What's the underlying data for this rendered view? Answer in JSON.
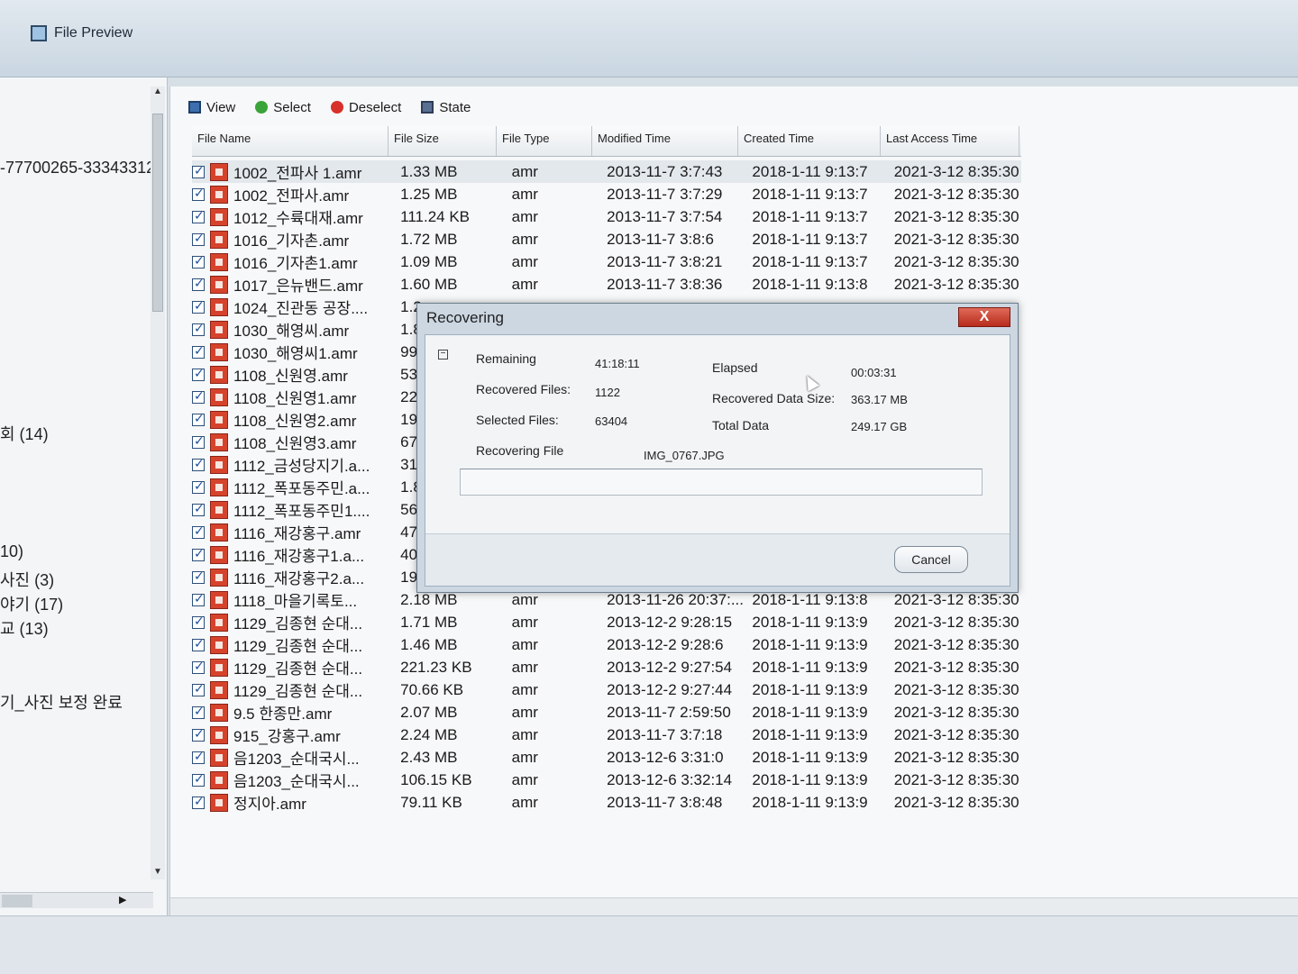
{
  "window": {
    "title": "File Preview"
  },
  "toolbar": {
    "view": "View",
    "select": "Select",
    "deselect": "Deselect",
    "state": "State"
  },
  "left_tree": [
    "-77700265-33343312",
    "회 (14)",
    "10)",
    "사진 (3)",
    "야기 (17)",
    "교 (13)",
    "기_사진 보정 완료"
  ],
  "table": {
    "headers": [
      "File Name",
      "File Size",
      "File Type",
      "Modified Time",
      "Created Time",
      "Last Access Time"
    ],
    "rows": [
      [
        "1002_전파사 1.amr",
        "1.33 MB",
        "amr",
        "2013-11-7 3:7:43",
        "2018-1-11 9:13:7",
        "2021-3-12 8:35:30"
      ],
      [
        "1002_전파사.amr",
        "1.25 MB",
        "amr",
        "2013-11-7 3:7:29",
        "2018-1-11 9:13:7",
        "2021-3-12 8:35:30"
      ],
      [
        "1012_수륙대재.amr",
        "111.24 KB",
        "amr",
        "2013-11-7 3:7:54",
        "2018-1-11 9:13:7",
        "2021-3-12 8:35:30"
      ],
      [
        "1016_기자촌.amr",
        "1.72 MB",
        "amr",
        "2013-11-7 3:8:6",
        "2018-1-11 9:13:7",
        "2021-3-12 8:35:30"
      ],
      [
        "1016_기자촌1.amr",
        "1.09 MB",
        "amr",
        "2013-11-7 3:8:21",
        "2018-1-11 9:13:7",
        "2021-3-12 8:35:30"
      ],
      [
        "1017_은뉴밴드.amr",
        "1.60 MB",
        "amr",
        "2013-11-7 3:8:36",
        "2018-1-11 9:13:8",
        "2021-3-12 8:35:30"
      ],
      [
        "1024_진관동 공장....",
        "1.2",
        "",
        "",
        "",
        ""
      ],
      [
        "1030_해영씨.amr",
        "1.8",
        "",
        "",
        "",
        ""
      ],
      [
        "1030_해영씨1.amr",
        "99",
        "",
        "",
        "",
        ""
      ],
      [
        "1108_신원영.amr",
        "53",
        "",
        "",
        "",
        ""
      ],
      [
        "1108_신원영1.amr",
        "22",
        "",
        "",
        "",
        ""
      ],
      [
        "1108_신원영2.amr",
        "19.",
        "",
        "",
        "",
        ""
      ],
      [
        "1108_신원영3.amr",
        "67.",
        "",
        "",
        "",
        ""
      ],
      [
        "1112_금성당지기.a...",
        "31.",
        "",
        "",
        "",
        ""
      ],
      [
        "1112_폭포동주민.a...",
        "1.8",
        "",
        "",
        "",
        ""
      ],
      [
        "1112_폭포동주민1....",
        "56",
        "",
        "",
        "",
        ""
      ],
      [
        "1116_재강홍구.amr",
        "47.",
        "",
        "",
        "",
        ""
      ],
      [
        "1116_재강홍구1.a...",
        "40",
        "",
        "",
        "",
        ""
      ],
      [
        "1116_재강홍구2.a...",
        "19",
        "",
        "",
        "",
        ""
      ],
      [
        "1118_마을기록토...",
        "2.18 MB",
        "amr",
        "2013-11-26 20:37:...",
        "2018-1-11 9:13:8",
        "2021-3-12 8:35:30"
      ],
      [
        "1129_김종현 순대...",
        "1.71 MB",
        "amr",
        "2013-12-2 9:28:15",
        "2018-1-11 9:13:9",
        "2021-3-12 8:35:30"
      ],
      [
        "1129_김종현 순대...",
        "1.46 MB",
        "amr",
        "2013-12-2 9:28:6",
        "2018-1-11 9:13:9",
        "2021-3-12 8:35:30"
      ],
      [
        "1129_김종현 순대...",
        "221.23 KB",
        "amr",
        "2013-12-2 9:27:54",
        "2018-1-11 9:13:9",
        "2021-3-12 8:35:30"
      ],
      [
        "1129_김종현 순대...",
        "70.66 KB",
        "amr",
        "2013-12-2 9:27:44",
        "2018-1-11 9:13:9",
        "2021-3-12 8:35:30"
      ],
      [
        "9.5 한종만.amr",
        "2.07 MB",
        "amr",
        "2013-11-7 2:59:50",
        "2018-1-11 9:13:9",
        "2021-3-12 8:35:30"
      ],
      [
        "915_강홍구.amr",
        "2.24 MB",
        "amr",
        "2013-11-7 3:7:18",
        "2018-1-11 9:13:9",
        "2021-3-12 8:35:30"
      ],
      [
        "음1203_순대국시...",
        "2.43 MB",
        "amr",
        "2013-12-6 3:31:0",
        "2018-1-11 9:13:9",
        "2021-3-12 8:35:30"
      ],
      [
        "음1203_순대국시...",
        "106.15 KB",
        "amr",
        "2013-12-6 3:32:14",
        "2018-1-11 9:13:9",
        "2021-3-12 8:35:30"
      ],
      [
        "정지아.amr",
        "79.11 KB",
        "amr",
        "2013-11-7 3:8:48",
        "2018-1-11 9:13:9",
        "2021-3-12 8:35:30"
      ]
    ]
  },
  "dialog": {
    "title": "Recovering",
    "close": "X",
    "remaining_label": "Remaining",
    "remaining_value": "41:18:11",
    "elapsed_label": "Elapsed",
    "elapsed_value": "00:03:31",
    "recovered_files_label": "Recovered Files:",
    "recovered_files_value": "1122",
    "recovered_size_label": "Recovered Data Size:",
    "recovered_size_value": "363.17 MB",
    "selected_files_label": "Selected Files:",
    "selected_files_value": "63404",
    "total_data_label": "Total Data",
    "total_data_value": "249.17 GB",
    "recovering_file_label": "Recovering File",
    "recovering_file_value": "IMG_0767.JPG",
    "cancel": "Cancel",
    "progress": 0.0
  }
}
